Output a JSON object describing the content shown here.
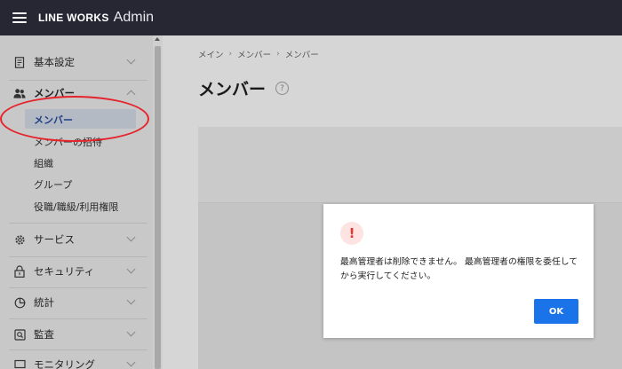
{
  "header": {
    "brand_main": "LINE WORKS",
    "brand_sub": "Admin"
  },
  "sidebar": {
    "groups": [
      {
        "label": "基本設定",
        "icon": "document-icon",
        "expanded": false
      },
      {
        "label": "メンバー",
        "icon": "members-icon",
        "expanded": true,
        "items": [
          {
            "label": "メンバー",
            "active": true
          },
          {
            "label": "メンバーの招待"
          },
          {
            "label": "組織"
          },
          {
            "label": "グループ"
          },
          {
            "label": "役職/職級/利用権限"
          }
        ]
      },
      {
        "label": "サービス",
        "icon": "gear-icon",
        "expanded": false
      },
      {
        "label": "セキュリティ",
        "icon": "lock-icon",
        "expanded": false
      },
      {
        "label": "統計",
        "icon": "pie-chart-icon",
        "expanded": false
      },
      {
        "label": "監査",
        "icon": "search-document-icon",
        "expanded": false
      },
      {
        "label": "モニタリング",
        "icon": "monitor-icon",
        "expanded": false
      }
    ]
  },
  "main": {
    "breadcrumb": [
      "メイン",
      "メンバー",
      "メンバー"
    ],
    "title": "メンバー",
    "help": "?"
  },
  "dialog": {
    "icon": "!",
    "message": "最高管理者は削除できません。 最高管理者の権限を委任してから実行してください。",
    "ok_label": "OK"
  },
  "colors": {
    "header_bg": "#262732",
    "accent": "#1a73e8",
    "alert": "#e7352f",
    "highlight_ellipse": "#e5242b"
  }
}
